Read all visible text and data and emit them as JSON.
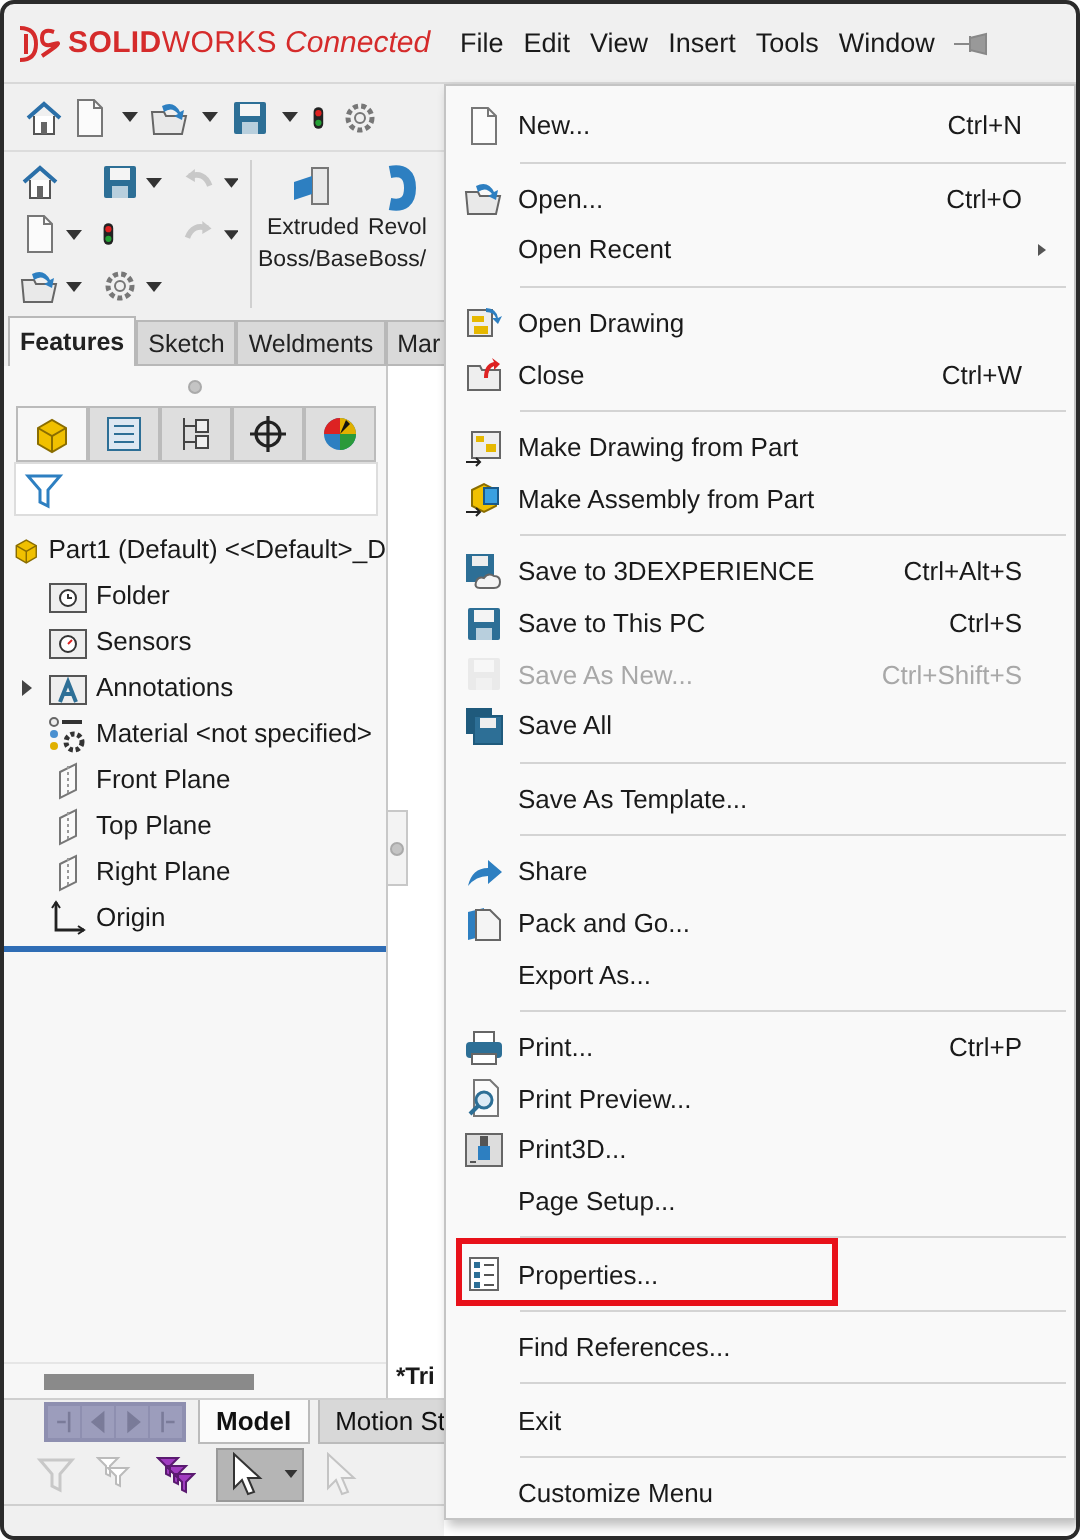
{
  "app": {
    "brand": "**SOLID**WORKS",
    "edition": "Connected"
  },
  "menubar": [
    "File",
    "Edit",
    "View",
    "Insert",
    "Tools",
    "Window"
  ],
  "history": {
    "undo_disabled": true,
    "redo_disabled": true
  },
  "command_manager": [
    {
      "lines": [
        "Extruded",
        "Boss/Base"
      ]
    },
    {
      "lines": [
        "Revol",
        "Boss/"
      ]
    }
  ],
  "tabs": [
    {
      "label": "Features",
      "selected": true
    },
    {
      "label": "Sketch",
      "selected": false
    },
    {
      "label": "Weldments",
      "selected": false
    },
    {
      "label": "Mar",
      "selected": false
    }
  ],
  "panel_tabs": [
    {
      "selected": true
    },
    {
      "selected": false
    },
    {
      "selected": false
    },
    {
      "selected": false
    },
    {
      "selected": false
    }
  ],
  "feature_tree": {
    "label": "Part1 (Default) <<Default>_D",
    "children": [
      {
        "label": "Folder",
        "expandable": false
      },
      {
        "label": "Sensors",
        "expandable": false
      },
      {
        "label": "Annotations",
        "expandable": true
      },
      {
        "label": "Material <not specified>",
        "expandable": false
      },
      {
        "label": "Front Plane",
        "expandable": false
      },
      {
        "label": "Top Plane",
        "expandable": false
      },
      {
        "label": "Right Plane",
        "expandable": false
      },
      {
        "label": "Origin",
        "expandable": false
      }
    ]
  },
  "graphics": {
    "title": "*Tri"
  },
  "bottom_tabs": [
    {
      "label": "Model",
      "selected": true
    },
    {
      "label": "Motion St",
      "selected": false
    }
  ],
  "select_tool": {
    "selected": true
  },
  "file_menu": {
    "groups": [
      {
        "items": [
          {
            "label": "New...",
            "shortcut": "Ctrl+N",
            "disabled": false,
            "submenu": false,
            "highlighted": false
          }
        ]
      },
      {
        "items": [
          {
            "label": "Open...",
            "shortcut": "Ctrl+O",
            "disabled": false,
            "submenu": false,
            "highlighted": false
          },
          {
            "label": "Open Recent",
            "disabled": false,
            "submenu": true,
            "highlighted": false
          }
        ]
      },
      {
        "items": [
          {
            "label": "Open Drawing",
            "disabled": false,
            "submenu": false,
            "highlighted": false
          },
          {
            "label": "Close",
            "shortcut": "Ctrl+W",
            "disabled": false,
            "submenu": false,
            "highlighted": false
          }
        ]
      },
      {
        "items": [
          {
            "label": "Make Drawing from Part",
            "disabled": false,
            "submenu": false,
            "highlighted": false
          },
          {
            "label": "Make Assembly from Part",
            "disabled": false,
            "submenu": false,
            "highlighted": false
          }
        ]
      },
      {
        "items": [
          {
            "label": "Save to 3DEXPERIENCE",
            "shortcut": "Ctrl+Alt+S",
            "disabled": false,
            "submenu": false,
            "highlighted": false
          },
          {
            "label": "Save to This PC",
            "shortcut": "Ctrl+S",
            "disabled": false,
            "submenu": false,
            "highlighted": false
          },
          {
            "label": "Save As New...",
            "shortcut": "Ctrl+Shift+S",
            "disabled": true,
            "submenu": false,
            "highlighted": false
          },
          {
            "label": "Save All",
            "disabled": false,
            "submenu": false,
            "highlighted": false
          }
        ]
      },
      {
        "items": [
          {
            "label": "Save As Template...",
            "disabled": false,
            "submenu": false,
            "highlighted": false
          }
        ]
      },
      {
        "items": [
          {
            "label": "Share",
            "disabled": false,
            "submenu": false,
            "highlighted": false
          },
          {
            "label": "Pack and Go...",
            "disabled": false,
            "submenu": false,
            "highlighted": false
          },
          {
            "label": "Export As...",
            "disabled": false,
            "submenu": false,
            "highlighted": false
          }
        ]
      },
      {
        "items": [
          {
            "label": "Print...",
            "shortcut": "Ctrl+P",
            "disabled": false,
            "submenu": false,
            "highlighted": false
          },
          {
            "label": "Print Preview...",
            "disabled": false,
            "submenu": false,
            "highlighted": false
          },
          {
            "label": "Print3D...",
            "disabled": false,
            "submenu": false,
            "highlighted": false
          },
          {
            "label": "Page Setup...",
            "disabled": false,
            "submenu": false,
            "highlighted": false
          }
        ]
      },
      {
        "items": [
          {
            "label": "Properties...",
            "disabled": false,
            "submenu": false,
            "highlighted": true
          }
        ]
      },
      {
        "items": [
          {
            "label": "Find References...",
            "disabled": false,
            "submenu": false,
            "highlighted": false
          }
        ]
      },
      {
        "items": [
          {
            "label": "Exit",
            "disabled": false,
            "submenu": false,
            "highlighted": false
          }
        ]
      },
      {
        "items": [
          {
            "label": "Customize Menu",
            "disabled": false,
            "submenu": false,
            "highlighted": false
          }
        ]
      }
    ]
  }
}
